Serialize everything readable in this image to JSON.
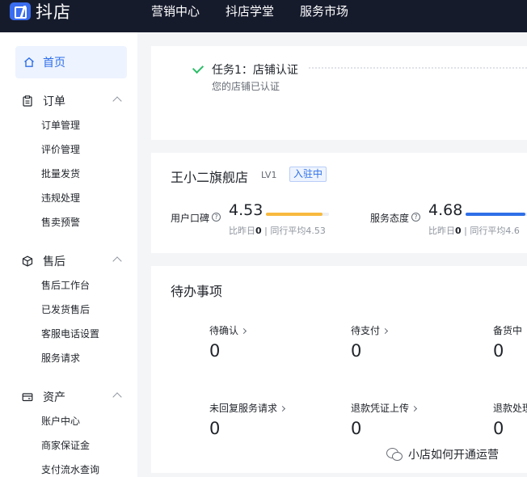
{
  "header": {
    "app_name": "抖店",
    "nav": [
      "营销中心",
      "抖店学堂",
      "服务市场"
    ]
  },
  "sidebar": {
    "home_label": "首页",
    "groups": [
      {
        "label": "订单",
        "icon": "clipboard-icon",
        "items": [
          "订单管理",
          "评价管理",
          "批量发货",
          "违规处理",
          "售卖预警"
        ]
      },
      {
        "label": "售后",
        "icon": "box-icon",
        "items": [
          "售后工作台",
          "已发货售后",
          "客服电话设置",
          "服务请求"
        ]
      },
      {
        "label": "资产",
        "icon": "wallet-icon",
        "items": [
          "账户中心",
          "商家保证金",
          "支付流水查询"
        ]
      }
    ]
  },
  "task": {
    "title": "任务1：店铺认证",
    "subtitle": "您的店铺已认证",
    "status": "completed"
  },
  "shop": {
    "name": "王小二旗舰店",
    "level": "LV1",
    "badge": "入驻中",
    "metrics": [
      {
        "label": "用户口碑",
        "value": "4.53",
        "fill_fraction": 0.9,
        "color": "#f7b93e",
        "sub_prefix": "比昨日",
        "sub_change": "0",
        "sub_avg": "同行平均4.53"
      },
      {
        "label": "服务态度",
        "value": "4.68",
        "fill_fraction": 0.95,
        "color": "#2f6fe8",
        "sub_prefix": "比昨日",
        "sub_change": "0",
        "sub_avg": "同行平均4.6"
      }
    ]
  },
  "todo": {
    "title": "待办事项",
    "items": [
      {
        "label": "待确认",
        "count": "0"
      },
      {
        "label": "待支付",
        "count": "0"
      },
      {
        "label": "备货中",
        "count": "0"
      },
      {
        "label": "未回复服务请求",
        "count": "0"
      },
      {
        "label": "退款凭证上传",
        "count": "0"
      },
      {
        "label": "退款处理",
        "count": "0"
      }
    ]
  },
  "watermark": {
    "text": "小店如何开通运营"
  },
  "colors": {
    "accent": "#2f6fe8",
    "topbar": "#161b2c",
    "success": "#2fbd6b",
    "rating_bar": "#f7b93e"
  }
}
